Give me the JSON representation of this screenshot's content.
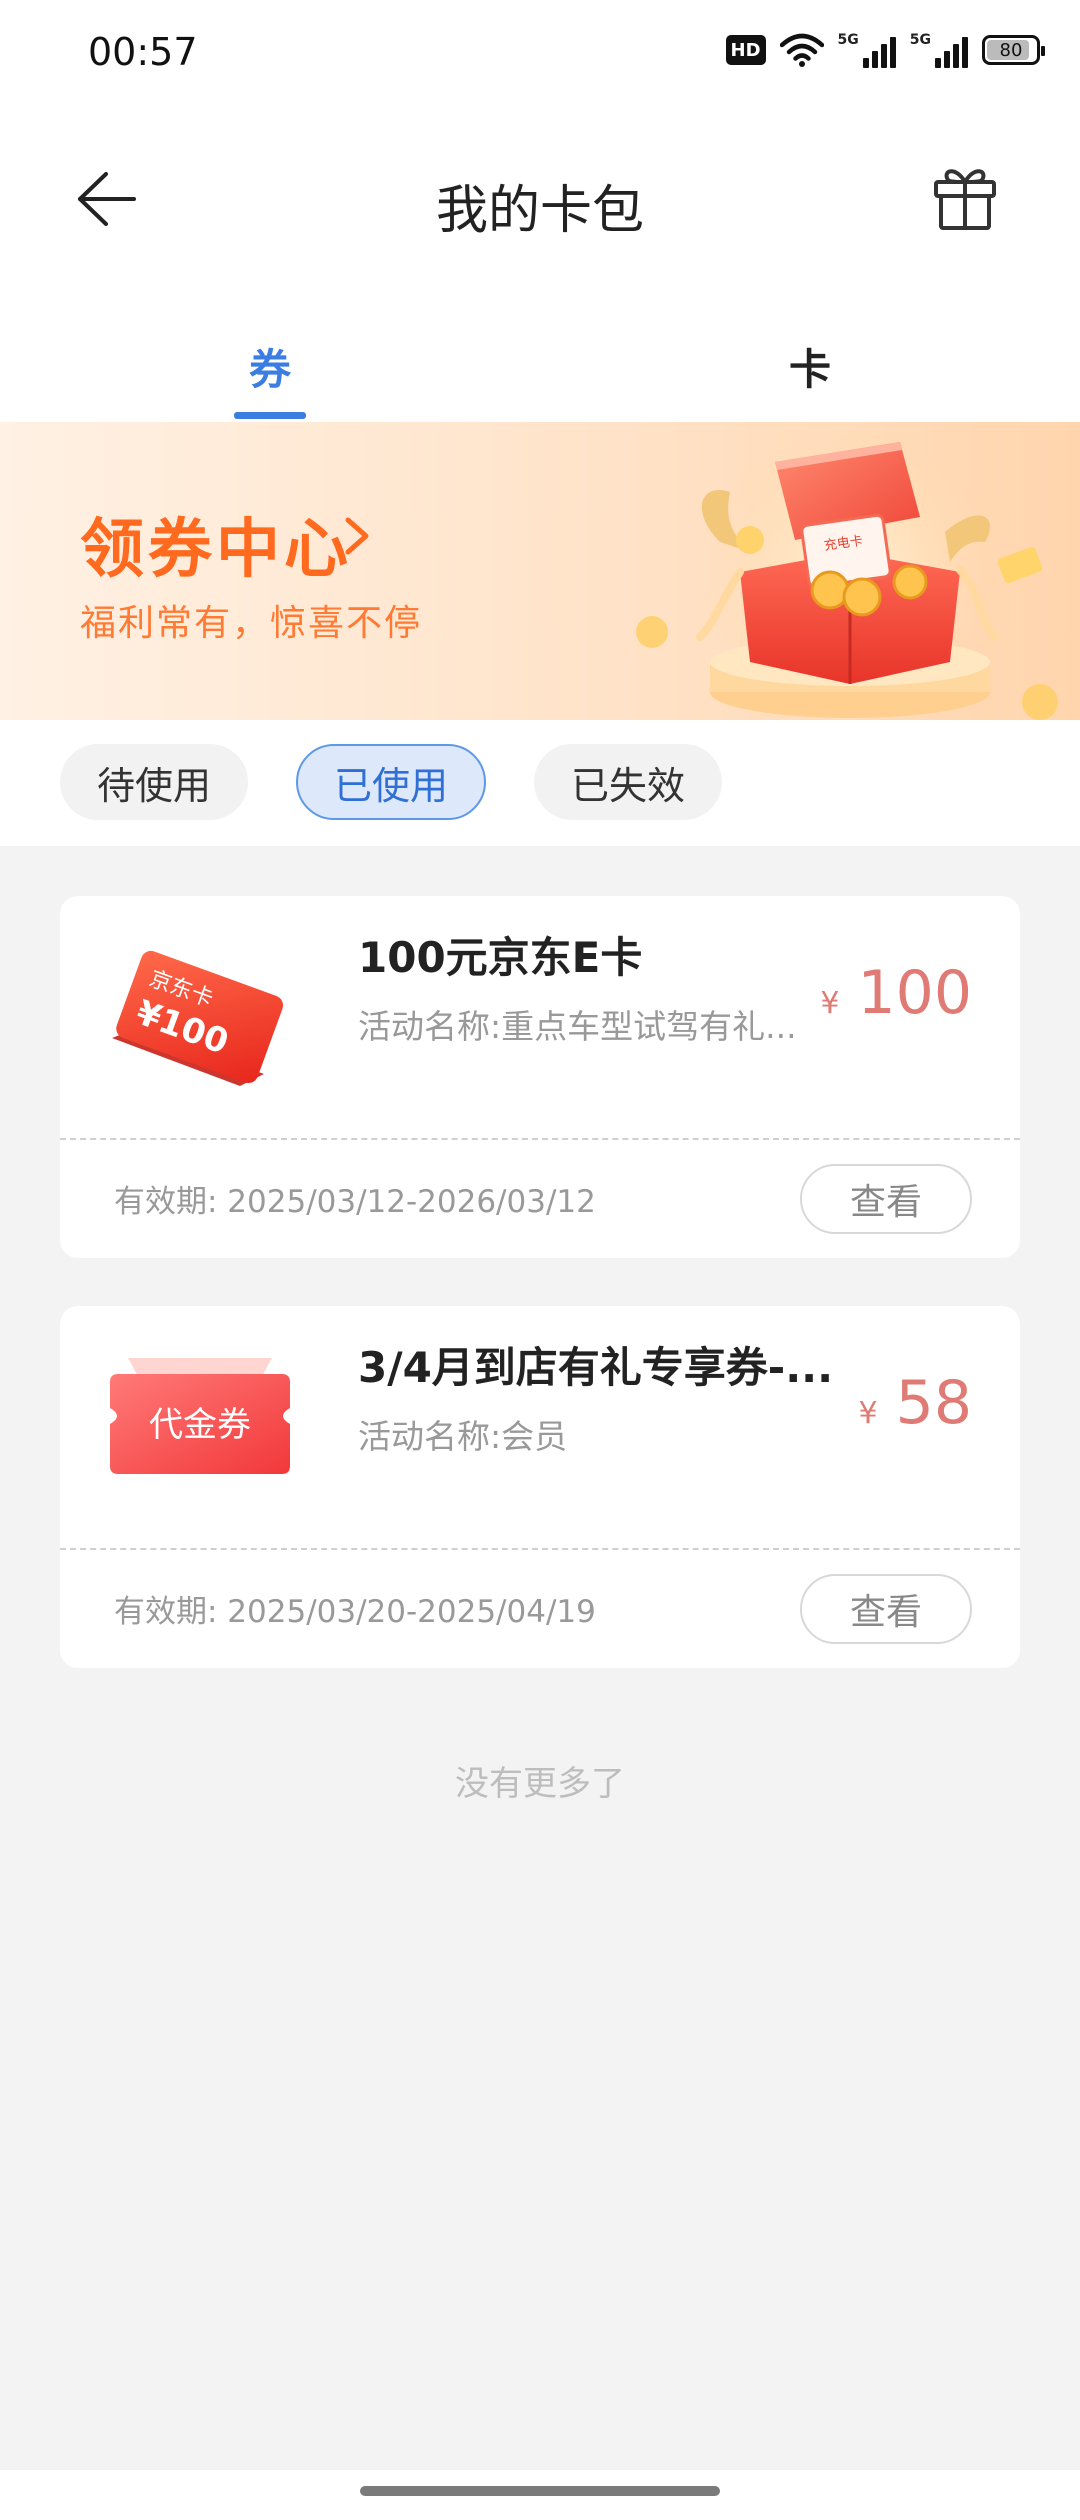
{
  "status_bar": {
    "time": "00:57",
    "hd_label": "HD",
    "signal_1_label": "5G",
    "signal_2_label": "5G",
    "battery_level": "80",
    "icons": [
      "hd-icon",
      "wifi-icon",
      "signal-5g-icon",
      "signal-5g-icon",
      "battery-icon"
    ]
  },
  "header": {
    "title": "我的卡包",
    "back_icon": "arrow-left-icon",
    "right_icon": "gift-icon"
  },
  "tabs": [
    {
      "label": "券",
      "active": true
    },
    {
      "label": "卡",
      "active": false
    }
  ],
  "banner": {
    "title": "领券中心",
    "subtitle": "福利常有，惊喜不停",
    "chevron_icon": "chevron-right-icon",
    "illustration_card_label": "充电卡"
  },
  "filters": [
    {
      "label": "待使用",
      "selected": false
    },
    {
      "label": "已使用",
      "selected": true
    },
    {
      "label": "已失效",
      "selected": false
    }
  ],
  "coupons": [
    {
      "thumb_label": "京东卡",
      "thumb_amount": "¥100",
      "title": "100元京东E卡",
      "activity": "活动名称:重点车型试驾有礼...",
      "currency": "¥",
      "amount": "100",
      "validity": "有效期: 2025/03/12-2026/03/12",
      "action": "查看"
    },
    {
      "thumb_label": "代金券",
      "title": "3/4月到店有礼专享券-...",
      "activity": "活动名称:会员",
      "currency": "¥",
      "amount": "58",
      "validity": "有效期: 2025/03/20-2025/04/19",
      "action": "查看"
    }
  ],
  "footer": {
    "no_more": "没有更多了"
  },
  "colors": {
    "accent_blue": "#3b7de0",
    "banner_orange": "#ff6a1f",
    "price_red": "#e07a74",
    "page_bg": "#f3f3f3"
  }
}
